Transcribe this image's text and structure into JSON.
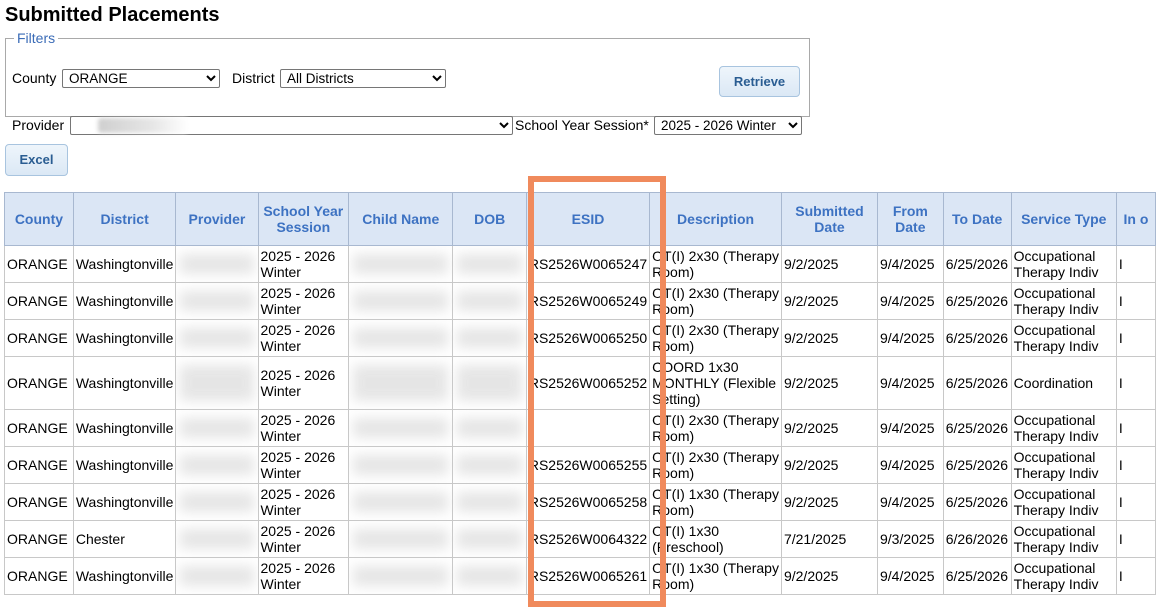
{
  "page": {
    "title": "Submitted Placements"
  },
  "filters": {
    "legend": "Filters",
    "county_label": "County",
    "county_value": "ORANGE",
    "district_label": "District",
    "district_value": "All Districts",
    "provider_label": "Provider",
    "provider_value": "",
    "session_label": "School Year Session*",
    "session_value": "2025 - 2026 Winter",
    "retrieve_label": "Retrieve"
  },
  "toolbar": {
    "excel_label": "Excel"
  },
  "table": {
    "headers": [
      "County",
      "District",
      "Provider",
      "School Year Session",
      "Child Name",
      "DOB",
      "ESID",
      "Description",
      "Submitted Date",
      "From Date",
      "To Date",
      "Service Type",
      "In o"
    ],
    "rows": [
      {
        "county": "ORANGE",
        "district": "Washingtonville",
        "session": "2025 - 2026 Winter",
        "esid": "RS2526W0065247",
        "description": "OT(I) 2x30 (Therapy Room)",
        "submitted": "9/2/2025",
        "from": "9/4/2025",
        "to": "6/25/2026",
        "service": "Occupational Therapy Indiv",
        "extra": "I"
      },
      {
        "county": "ORANGE",
        "district": "Washingtonville",
        "session": "2025 - 2026 Winter",
        "esid": "RS2526W0065249",
        "description": "OT(I) 2x30 (Therapy Room)",
        "submitted": "9/2/2025",
        "from": "9/4/2025",
        "to": "6/25/2026",
        "service": "Occupational Therapy Indiv",
        "extra": "I"
      },
      {
        "county": "ORANGE",
        "district": "Washingtonville",
        "session": "2025 - 2026 Winter",
        "esid": "RS2526W0065250",
        "description": "OT(I) 2x30 (Therapy Room)",
        "submitted": "9/2/2025",
        "from": "9/4/2025",
        "to": "6/25/2026",
        "service": "Occupational Therapy Indiv",
        "extra": "I"
      },
      {
        "county": "ORANGE",
        "district": "Washingtonville",
        "session": "2025 - 2026 Winter",
        "esid": "RS2526W0065252",
        "description": "COORD 1x30 MONTHLY (Flexible Setting)",
        "submitted": "9/2/2025",
        "from": "9/4/2025",
        "to": "6/25/2026",
        "service": "Coordination",
        "extra": "I"
      },
      {
        "county": "ORANGE",
        "district": "Washingtonville",
        "session": "2025 - 2026 Winter",
        "esid": "",
        "description": "OT(I) 2x30 (Therapy Room)",
        "submitted": "9/2/2025",
        "from": "9/4/2025",
        "to": "6/25/2026",
        "service": "Occupational Therapy Indiv",
        "extra": "I"
      },
      {
        "county": "ORANGE",
        "district": "Washingtonville",
        "session": "2025 - 2026 Winter",
        "esid": "RS2526W0065255",
        "description": "OT(I) 2x30 (Therapy Room)",
        "submitted": "9/2/2025",
        "from": "9/4/2025",
        "to": "6/25/2026",
        "service": "Occupational Therapy Indiv",
        "extra": "I"
      },
      {
        "county": "ORANGE",
        "district": "Washingtonville",
        "session": "2025 - 2026 Winter",
        "esid": "RS2526W0065258",
        "description": "OT(I) 1x30 (Therapy Room)",
        "submitted": "9/2/2025",
        "from": "9/4/2025",
        "to": "6/25/2026",
        "service": "Occupational Therapy Indiv",
        "extra": "I"
      },
      {
        "county": "ORANGE",
        "district": "Chester",
        "session": "2025 - 2026 Winter",
        "esid": "RS2526W0064322",
        "description": "OT(I) 1x30 (Preschool)",
        "submitted": "7/21/2025",
        "from": "9/3/2025",
        "to": "6/26/2026",
        "service": "Occupational Therapy Indiv",
        "extra": "I"
      },
      {
        "county": "ORANGE",
        "district": "Washingtonville",
        "session": "2025 - 2026 Winter",
        "esid": "RS2526W0065261",
        "description": "OT(I) 1x30 (Therapy Room)",
        "submitted": "9/2/2025",
        "from": "9/4/2025",
        "to": "6/25/2026",
        "service": "Occupational Therapy Indiv",
        "extra": "I"
      }
    ]
  },
  "colors": {
    "highlight": "#f08a5c",
    "header_bg": "#dbe6f5",
    "header_text": "#3d72c2"
  }
}
